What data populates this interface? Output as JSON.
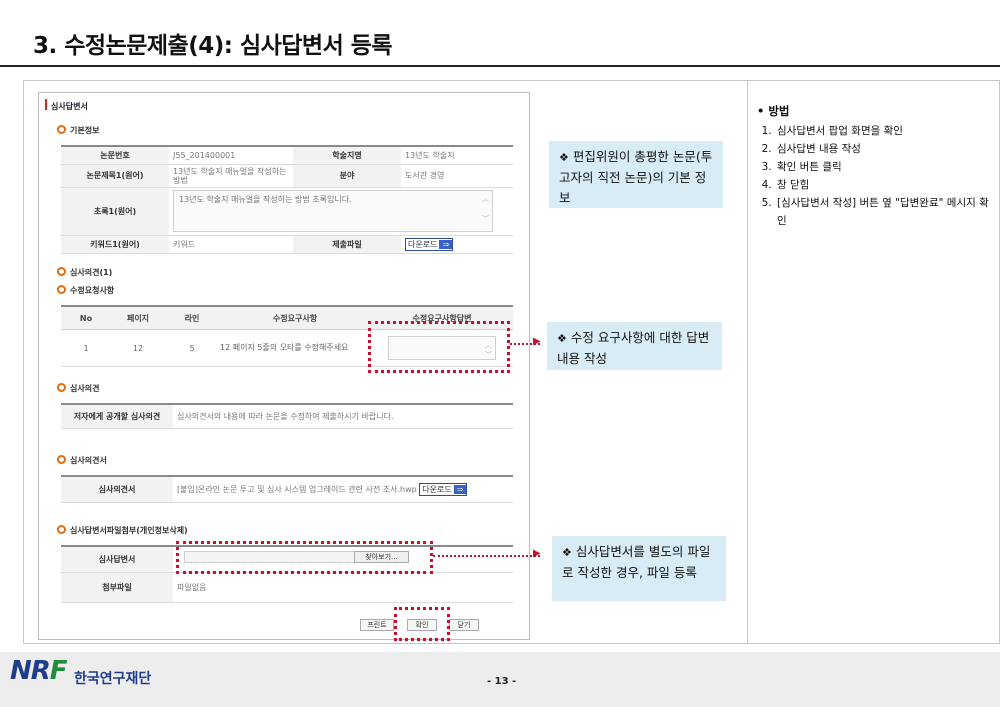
{
  "slide": {
    "title": "3. 수정논문제출(4): 심사답변서 등록"
  },
  "popup": {
    "title": "심사답변서",
    "basic_info": {
      "section": "기본정보",
      "paper_no_label": "논문번호",
      "paper_no_value": "J55_201400001",
      "conference_label": "학술지명",
      "conference_value": "13년도 학술지",
      "title_label": "논문제목1(원어)",
      "title_value": "13년도 학술지 매뉴얼을 작성하는 방법",
      "field_label": "분야",
      "field_value": "도서관 경영",
      "abstract_label": "초록1(원어)",
      "abstract_value": "13년도 학술지 매뉴얼을 작성하는 방법 초록입니다.",
      "keyword_label": "키워드1(원어)",
      "keyword_value": "키워드",
      "file_label": "제출파일",
      "download_label": "다운로드"
    },
    "opinion1": {
      "section": "심사의견(1)"
    },
    "revision": {
      "section": "수정요청사항",
      "headers": [
        "No",
        "페이지",
        "라인",
        "수정요구사항",
        "수정요구사항답변"
      ],
      "rows": [
        {
          "no": "1",
          "page": "12",
          "line": "5",
          "request": "12 페이지 5줄의 오타를 수정해주세요"
        }
      ]
    },
    "opinion": {
      "section": "심사의견",
      "label": "저자에게 공개할 심사의견",
      "value": "심사의견서의 내용에 따라 논문을 수정하여 제출하시기 바랍니다."
    },
    "opinion_doc": {
      "section": "심사의견서",
      "label": "심사의견서",
      "value": "[붙임]온라인 논문 투고 및 심사 시스템 업그레이드 관련 사전 조사.hwp",
      "download_label": "다운로드"
    },
    "attach": {
      "section": "심사답변서파일첨부(개인정보삭제)",
      "reply_label": "심사답변서",
      "browse_label": "찾아보기...",
      "attach_label": "첨부파일",
      "attach_value": "파일없음"
    },
    "buttons": {
      "print": "프린트",
      "confirm": "확인",
      "close": "닫기"
    }
  },
  "callouts": {
    "c1": "편집위원이 총평한 논문(투고자의 직전 논문)의 기본 정보",
    "c2": "수정 요구사항에 대한 답변 내용 작성",
    "c3": "심사답변서를 별도의 파일로 작성한 경우, 파일 등록",
    "mark": "❖"
  },
  "method": {
    "head": "• 방법",
    "steps": [
      "심사답변서 팝업 화면을 확인",
      "심사답변 내용 작성",
      "확인 버튼 클릭",
      "창 닫힘",
      "[심사답변서 작성] 버튼 옆 \"답변완료\" 메시지 확인"
    ]
  },
  "footer": {
    "logo_a": "NR",
    "logo_b": "F",
    "org": "한국연구재단",
    "page": "- 13 -"
  },
  "colors": {
    "highlight": "#c8102e",
    "callout_bg": "#d7ecf4",
    "section_dot": "#e06a10"
  }
}
